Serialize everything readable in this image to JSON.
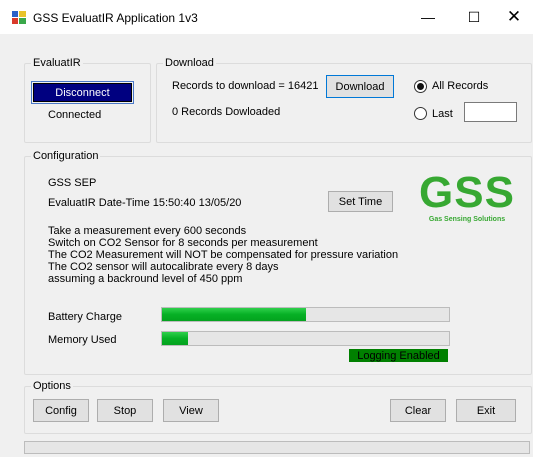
{
  "window": {
    "title": "GSS EvaluatIR Application 1v3",
    "minimize_glyph": "—",
    "maximize_glyph": "☐",
    "close_glyph": "✕"
  },
  "evaluatir": {
    "title": "EvaluatIR",
    "disconnect_label": "Disconnect",
    "status": "Connected"
  },
  "download": {
    "title": "Download",
    "records_text": "Records to download = 16421",
    "download_label": "Download",
    "downloaded_text": "0 Records Dowloaded",
    "all_records_label": "All Records",
    "last_label": "Last",
    "last_value": "",
    "selected_option": "All Records"
  },
  "configuration": {
    "title": "Configuration",
    "device_name": "GSS SEP",
    "datetime_text": "EvaluatIR Date-Time 15:50:40 13/05/20",
    "set_time_label": "Set Time",
    "info_lines": [
      "Take a measurement every 600 seconds",
      "Switch on CO2 Sensor for 8 seconds per measurement",
      "The CO2 Measurement will NOT be compensated for pressure variation",
      "The CO2 sensor will autocalibrate every 8 days",
      "assuming a backround level of 450 ppm"
    ],
    "battery_label": "Battery Charge",
    "battery_fraction": 0.5,
    "memory_label": "Memory Used",
    "memory_fraction": 0.09,
    "logging_status": "Logging Enabled",
    "logo_text": "GSS",
    "logo_subtitle": "Gas Sensing Solutions",
    "brand_color": "#37a832"
  },
  "options": {
    "title": "Options",
    "config_label": "Config",
    "stop_label": "Stop",
    "view_label": "View",
    "clear_label": "Clear",
    "exit_label": "Exit"
  }
}
